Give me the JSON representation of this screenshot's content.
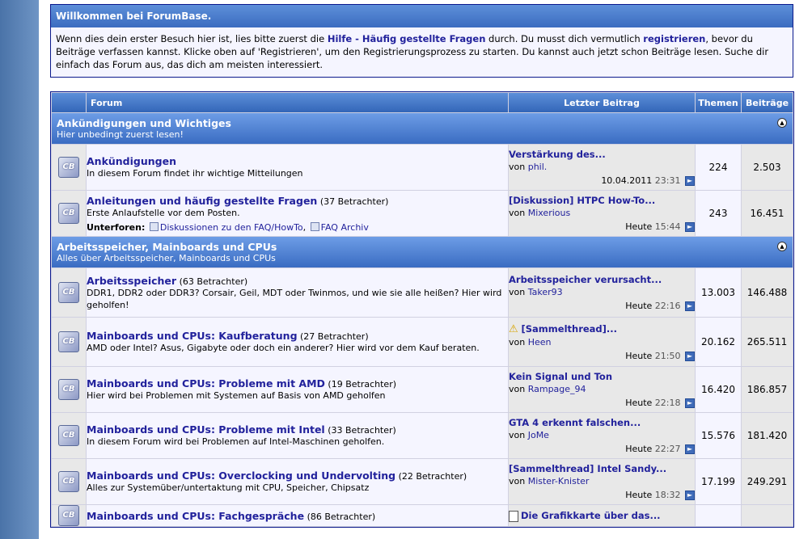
{
  "welcome": {
    "title": "Willkommen bei ForumBase.",
    "p1": "Wenn dies dein erster Besuch hier ist, lies bitte zuerst die ",
    "faq_link": "Hilfe - Häufig gestellte Fragen",
    "p2": " durch. Du musst dich vermutlich ",
    "register_link": "registrieren",
    "p3": ", bevor du Beiträge verfassen kannst. Klicke oben auf 'Registrieren', um den Registrierungsprozess zu starten. Du kannst auch jetzt schon Beiträge lesen. Suche dir einfach das Forum aus, das dich am meisten interessiert."
  },
  "table_headers": {
    "forum": "Forum",
    "last_post": "Letzter Beitrag",
    "threads": "Themen",
    "posts": "Beiträge"
  },
  "categories": [
    {
      "title": "Ankündigungen und Wichtiges",
      "desc": "Hier unbedingt zuerst lesen!",
      "forums": [
        {
          "title": "Ankündigungen",
          "viewers": "",
          "desc": "In diesem Forum findet ihr wichtige Mitteilungen",
          "last_title": "Verstärkung des...",
          "last_by_prefix": "von ",
          "last_user": "phil.",
          "last_date": "10.04.2011",
          "last_time": "23:31",
          "threads": "224",
          "posts": "2.503"
        },
        {
          "title": "Anleitungen und häufig gestellte Fragen",
          "viewers": "(37 Betrachter)",
          "desc": "Erste Anlaufstelle vor dem Posten.",
          "subforum_label": "Unterforen:",
          "subforums": [
            "Diskussionen zu den FAQ/HowTo",
            "FAQ Archiv"
          ],
          "last_title": "[Diskussion] HTPC How-To...",
          "last_by_prefix": "von ",
          "last_user": "Mixerious",
          "last_date": "Heute",
          "last_time": "15:44",
          "threads": "243",
          "posts": "16.451"
        }
      ]
    },
    {
      "title": "Arbeitsspeicher, Mainboards und CPUs",
      "desc": "Alles über Arbeitsspeicher, Mainboards und CPUs",
      "forums": [
        {
          "title": "Arbeitsspeicher",
          "viewers": "(63 Betrachter)",
          "desc": "DDR1, DDR2 oder DDR3? Corsair, Geil, MDT oder Twinmos, und wie sie alle heißen? Hier wird geholfen!",
          "last_title": "Arbeitsspeicher verursacht...",
          "last_by_prefix": "von ",
          "last_user": "Taker93",
          "last_date": "Heute",
          "last_time": "22:16",
          "threads": "13.003",
          "posts": "146.488"
        },
        {
          "title": "Mainboards und CPUs: Kaufberatung",
          "viewers": "(27 Betrachter)",
          "desc": "AMD oder Intel? Asus, Gigabyte oder doch ein anderer? Hier wird vor dem Kauf beraten.",
          "last_title": "[Sammelthread]...",
          "last_icon": "warning-icon",
          "last_by_prefix": "von ",
          "last_user": "Heen",
          "last_date": "Heute",
          "last_time": "21:50",
          "threads": "20.162",
          "posts": "265.511"
        },
        {
          "title": "Mainboards und CPUs: Probleme mit AMD",
          "viewers": "(19 Betrachter)",
          "desc": "Hier wird bei Problemen mit Systemen auf Basis von AMD geholfen",
          "last_title": "Kein Signal und Ton",
          "last_by_prefix": "von ",
          "last_user": "Rampage_94",
          "last_date": "Heute",
          "last_time": "22:18",
          "threads": "16.420",
          "posts": "186.857"
        },
        {
          "title": "Mainboards und CPUs: Probleme mit Intel",
          "viewers": "(33 Betrachter)",
          "desc": "In diesem Forum wird bei Problemen auf Intel-Maschinen geholfen.",
          "last_title": "GTA 4 erkennt falschen...",
          "last_by_prefix": "von ",
          "last_user": "JoMe",
          "last_date": "Heute",
          "last_time": "22:27",
          "threads": "15.576",
          "posts": "181.420"
        },
        {
          "title": "Mainboards und CPUs: Overclocking und Undervolting",
          "viewers": "(22 Betrachter)",
          "desc": "Alles zur Systemüber/untertaktung mit CPU, Speicher, Chipsatz",
          "last_title": "[Sammelthread] Intel Sandy...",
          "last_by_prefix": "von ",
          "last_user": "Mister-Knister",
          "last_date": "Heute",
          "last_time": "18:32",
          "threads": "17.199",
          "posts": "249.291"
        },
        {
          "title": "Mainboards und CPUs: Fachgespräche",
          "viewers": "(86 Betrachter)",
          "desc": "",
          "last_title": "Die Grafikkarte über das...",
          "last_icon": "document-icon",
          "last_by_prefix": "",
          "last_user": "",
          "last_date": "",
          "last_time": "",
          "threads": "",
          "posts": ""
        }
      ]
    }
  ],
  "icon_text": "CB",
  "colors": {
    "header_blue": "#3b6cc0",
    "link": "#22229c",
    "row_light": "#f5f5ff",
    "row_gray": "#e8e8e8"
  }
}
